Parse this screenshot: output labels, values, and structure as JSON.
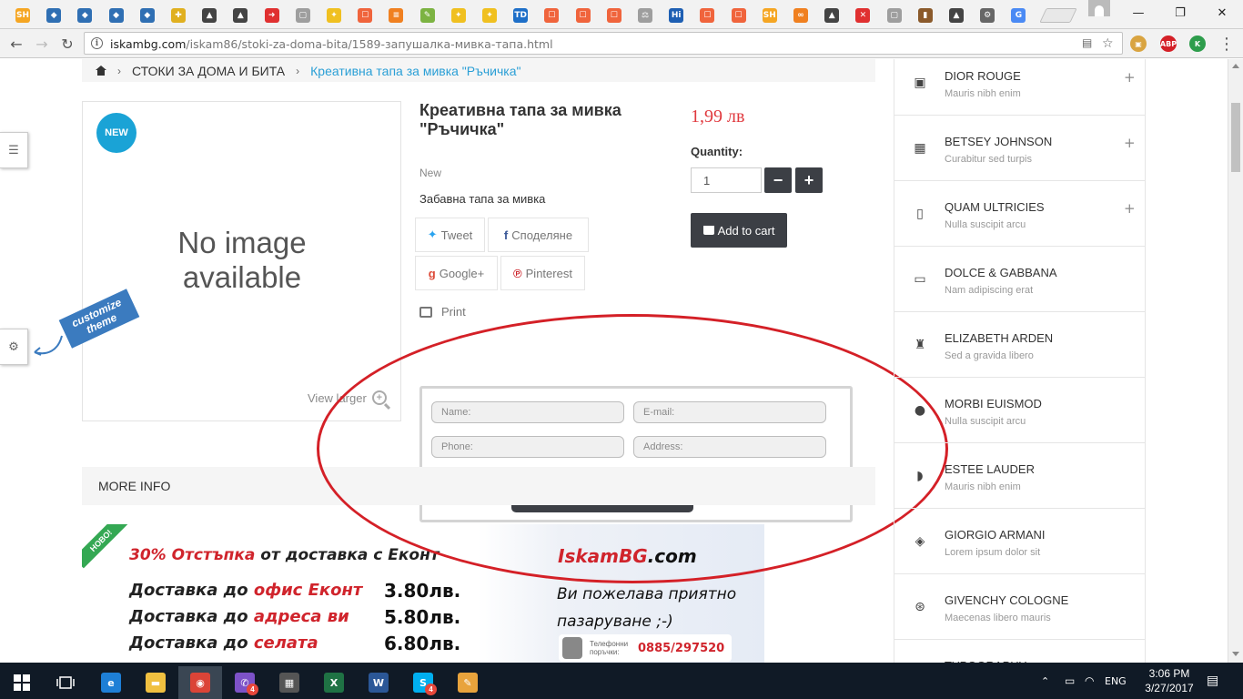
{
  "browser": {
    "tabs": [
      {
        "icon": "shopping-sh-icon",
        "glyph": "SH",
        "color": "#f5a623"
      },
      {
        "icon": "diamond-icon",
        "glyph": "◆",
        "color": "#2f6fb3"
      },
      {
        "icon": "diamond-icon",
        "glyph": "◆",
        "color": "#2f6fb3"
      },
      {
        "icon": "diamond-icon",
        "glyph": "◆",
        "color": "#2f6fb3"
      },
      {
        "icon": "diamond-icon",
        "glyph": "◆",
        "color": "#2f6fb3"
      },
      {
        "icon": "gift-icon",
        "glyph": "✚",
        "color": "#e0b020"
      },
      {
        "icon": "bag-icon",
        "glyph": "▲",
        "color": "#444444"
      },
      {
        "icon": "bag-icon",
        "glyph": "▲",
        "color": "#444444"
      },
      {
        "icon": "arrow-right-icon",
        "glyph": "➜",
        "color": "#e03030"
      },
      {
        "icon": "page-icon",
        "glyph": "▢",
        "color": "#9e9e9e"
      },
      {
        "icon": "tag-icon",
        "glyph": "✦",
        "color": "#f0c020"
      },
      {
        "icon": "aliexpress-icon",
        "glyph": "☐",
        "color": "#f0643c"
      },
      {
        "icon": "menu-lines-icon",
        "glyph": "≡",
        "color": "#f08020"
      },
      {
        "icon": "pencil-icon",
        "glyph": "✎",
        "color": "#7cb342"
      },
      {
        "icon": "tag-icon",
        "glyph": "✦",
        "color": "#f0c020"
      },
      {
        "icon": "tag-icon",
        "glyph": "✦",
        "color": "#f0c020"
      },
      {
        "icon": "td-icon",
        "glyph": "TD",
        "color": "#1e6fc8"
      },
      {
        "icon": "aliexpress-icon",
        "glyph": "☐",
        "color": "#f0643c"
      },
      {
        "icon": "aliexpress-icon",
        "glyph": "☐",
        "color": "#f0643c"
      },
      {
        "icon": "aliexpress-icon",
        "glyph": "☐",
        "color": "#f0643c"
      },
      {
        "icon": "scale-icon",
        "glyph": "⚖",
        "color": "#9e9e9e"
      },
      {
        "icon": "hi-icon",
        "glyph": "Hi",
        "color": "#1e5fb3"
      },
      {
        "icon": "aliexpress-icon",
        "glyph": "☐",
        "color": "#f0643c"
      },
      {
        "icon": "aliexpress-icon",
        "glyph": "☐",
        "color": "#f0643c"
      },
      {
        "icon": "shopping-sh-icon",
        "glyph": "SH",
        "color": "#f5a623"
      },
      {
        "icon": "link-icon",
        "glyph": "∞",
        "color": "#f08020"
      },
      {
        "icon": "bag-icon",
        "glyph": "▲",
        "color": "#444444"
      },
      {
        "icon": "close-circle-icon",
        "glyph": "✕",
        "color": "#e03030"
      },
      {
        "icon": "page-icon",
        "glyph": "▢",
        "color": "#9e9e9e"
      },
      {
        "icon": "book-icon",
        "glyph": "▮",
        "color": "#8b5a2b"
      },
      {
        "icon": "bag-icon",
        "glyph": "▲",
        "color": "#444444"
      },
      {
        "icon": "gear-icon",
        "glyph": "⚙",
        "color": "#666666"
      },
      {
        "icon": "translate-icon",
        "glyph": "G",
        "color": "#4a8af4"
      }
    ],
    "url_host": "iskambg.com",
    "url_path": "/iskam86/stoki-za-doma-bita/1589-запушалка-мивка-тапа.html",
    "extensions": [
      {
        "name": "photo-extension-icon",
        "glyph": "▣",
        "color": "#d9a441"
      },
      {
        "name": "adblock-plus-icon",
        "glyph": "ABP",
        "color": "#d42027"
      },
      {
        "name": "k-extension-icon",
        "glyph": "K",
        "color": "#2e9d4c"
      }
    ]
  },
  "breadcrumb": {
    "category": "СТОКИ ЗА ДОМА И БИТА",
    "current": "Креативна тапа за мивка \"Ръчичка\""
  },
  "product": {
    "badge": "NEW",
    "no_image": [
      "No image",
      "available"
    ],
    "view_larger": "View larger",
    "title": "Креативна тапа за мивка \"Ръчичка\"",
    "condition": "New",
    "short_description": "Забавна тапа за мивка",
    "share": {
      "tweet": "Tweet",
      "facebook": "Споделяне",
      "google": "Google+",
      "pinterest": "Pinterest"
    },
    "print": "Print",
    "price": "1,99 лв",
    "quantity_label": "Quantity:",
    "quantity_value": "1",
    "add_to_cart": "Add to cart"
  },
  "quick_order": {
    "name_placeholder": "Name:",
    "email_placeholder": "E-mail:",
    "phone_placeholder": "Phone:",
    "address_placeholder": "Address:"
  },
  "more_info": "MORE INFO",
  "banner": {
    "ribbon": "НОВО!",
    "headline_red": "30% Отстъпка",
    "headline_rest": " от доставка с Еконт",
    "rows": [
      {
        "prefix": "Доставка до ",
        "red": "офис Еконт",
        "value": "3.80лв."
      },
      {
        "prefix": "Доставка до ",
        "red": "адреса ви",
        "value": "5.80лв."
      },
      {
        "prefix": "Доставка до ",
        "red": "селата",
        "value": "6.80лв."
      }
    ],
    "brand_red": "IskamBG",
    "brand_black": ".com",
    "wish": "Ви пожелава приятно пазаруване ;-)",
    "phone_label": "Телефонни поръчки:",
    "phone_number": "0885/297520"
  },
  "customize_theme": "customize theme",
  "sidebar": {
    "items": [
      {
        "title": "DIOR ROUGE",
        "sub": "Mauris nibh enim",
        "icon": "camera-icon",
        "glyph": "▣",
        "plus": true
      },
      {
        "title": "BETSEY JOHNSON",
        "sub": "Curabitur sed turpis",
        "icon": "film-icon",
        "glyph": "▦",
        "plus": true
      },
      {
        "title": "QUAM ULTRICIES",
        "sub": "Nulla suscipit arcu",
        "icon": "phone-icon",
        "glyph": "▯",
        "plus": true
      },
      {
        "title": "DOLCE & GABBANA",
        "sub": "Nam adipiscing erat",
        "icon": "tv-icon",
        "glyph": "▭",
        "plus": false
      },
      {
        "title": "ELIZABETH ARDEN",
        "sub": "Sed a gravida libero",
        "icon": "shirt-icon",
        "glyph": "♜",
        "plus": false
      },
      {
        "title": "MORBI EUISMOD",
        "sub": "Nulla suscipit arcu",
        "icon": "user-icon",
        "glyph": "●",
        "plus": false
      },
      {
        "title": "ESTEE LAUDER",
        "sub": "Mauris nibh enim",
        "icon": "hat-icon",
        "glyph": "◗",
        "plus": false
      },
      {
        "title": "GIORGIO ARMANI",
        "sub": "Lorem ipsum dolor sit",
        "icon": "diamond-icon",
        "glyph": "◈",
        "plus": false
      },
      {
        "title": "GIVENCHY COLOGNE",
        "sub": "Maecenas libero mauris",
        "icon": "gamepad-icon",
        "glyph": "⊛",
        "plus": false
      },
      {
        "title": "TYPOGRAPHY",
        "sub": "",
        "icon": "print-icon",
        "glyph": "⎙",
        "plus": false
      }
    ]
  },
  "taskbar": {
    "apps": [
      {
        "name": "edge-icon",
        "glyph": "e",
        "color": "#1e7fd6"
      },
      {
        "name": "file-explorer-icon",
        "glyph": "▬",
        "color": "#f0c040"
      },
      {
        "name": "chrome-icon",
        "glyph": "◉",
        "color": "#db4437",
        "active": true
      },
      {
        "name": "viber-icon",
        "glyph": "✆",
        "color": "#7d52c8",
        "badge": "4"
      },
      {
        "name": "calculator-icon",
        "glyph": "▦",
        "color": "#555555"
      },
      {
        "name": "excel-icon",
        "glyph": "X",
        "color": "#1f7244"
      },
      {
        "name": "word-icon",
        "glyph": "W",
        "color": "#2b5797"
      },
      {
        "name": "skype-icon",
        "glyph": "S",
        "color": "#00aff0",
        "badge": "4"
      },
      {
        "name": "paint-icon",
        "glyph": "✎",
        "color": "#e8a33c"
      }
    ],
    "language": "ENG",
    "time": "3:06 PM",
    "date": "3/27/2017"
  }
}
